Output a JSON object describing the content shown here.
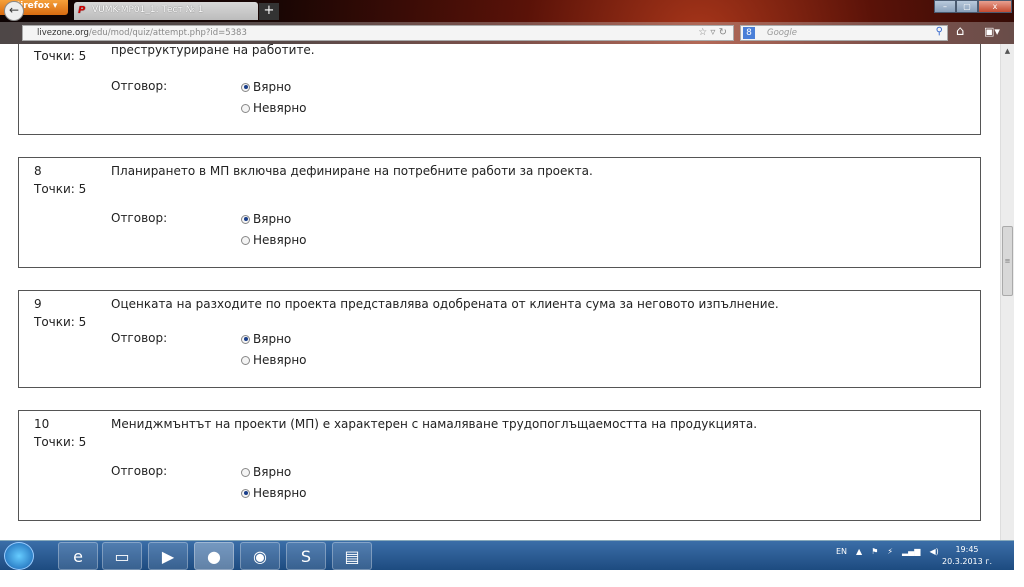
{
  "browser": {
    "menu_label": "Firefox ▾",
    "tab_title": "VUMK-MP01_1: Тест № 1",
    "new_tab": "+",
    "url_domain": "livezone.org",
    "url_path": "/edu/mod/quiz/attempt.php?id=5383",
    "search_placeholder": "Google",
    "min": "–",
    "max": "▢",
    "close": "x"
  },
  "quiz": {
    "answer_label": "Отговор:",
    "options": [
      "Вярно",
      "Невярно"
    ],
    "questions": [
      {
        "number": "",
        "points": "Точки: 5",
        "text": "преструктуриране на работите.",
        "selected": 0
      },
      {
        "number": "8",
        "points": "Точки: 5",
        "text": "Планирането в МП включва дефиниране на потребните работи за проекта.",
        "selected": 0
      },
      {
        "number": "9",
        "points": "Точки: 5",
        "text": "Оценката на разходите по проекта представлява одобрената от клиента сума за неговото изпълнение.",
        "selected": 0
      },
      {
        "number": "10",
        "points": "Точки: 5",
        "text": "Мениджмънтът на проекти (МП) е характерен с намаляване трудопоглъщаемостта на продукцията.",
        "selected": 1
      }
    ]
  },
  "taskbar": {
    "lang": "EN",
    "time": "19:45",
    "date": "20.3.2013 г."
  }
}
